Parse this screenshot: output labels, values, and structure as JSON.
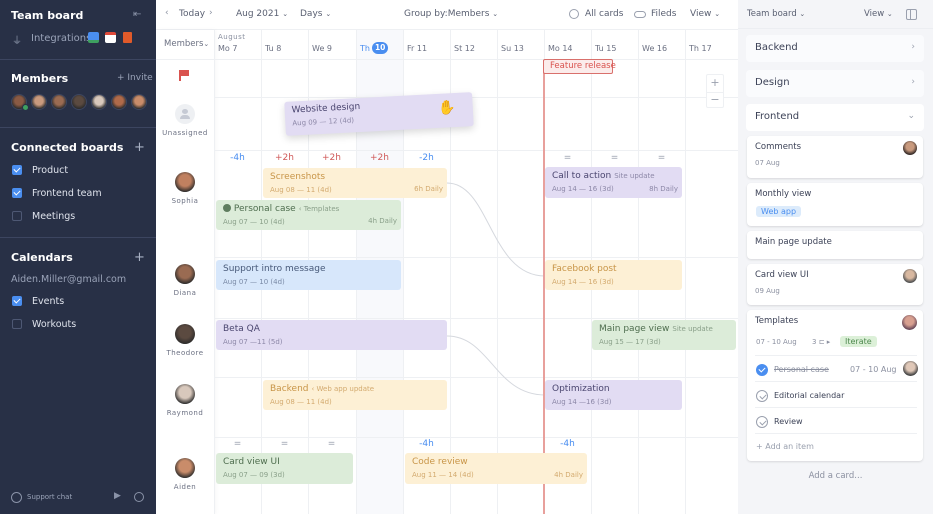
{
  "sidebar": {
    "title": "Team board",
    "integrations_label": "Integrations",
    "members_title": "Members",
    "invite_label": "+ Invite",
    "member_avatars": [
      "#8a5a44",
      "#c99a7e",
      "#9a6b52",
      "#5b4a40",
      "#d8c8bc",
      "#b06a4a",
      "#c98c6a"
    ],
    "connected_title": "Connected boards",
    "connected_boards": [
      {
        "label": "Product",
        "checked": true
      },
      {
        "label": "Frontend team",
        "checked": true
      },
      {
        "label": "Meetings",
        "checked": false
      }
    ],
    "calendars_title": "Calendars",
    "calendar_account": "Aiden.Miller@gmail.com",
    "calendars": [
      {
        "label": "Events",
        "checked": true
      },
      {
        "label": "Workouts",
        "checked": false
      }
    ],
    "support_label": "Support chat"
  },
  "toolbar": {
    "today": "Today",
    "month": "Aug 2021",
    "range": "Days",
    "group_by_prefix": "Group by:",
    "group_by_value": "Members",
    "all_cards": "All cards",
    "fields": "Fileds",
    "view": "View"
  },
  "grid": {
    "members_header": "Members",
    "month_label": "August",
    "days": [
      "Mo 7",
      "Tu 8",
      "We 9",
      "Th",
      "Fr 11",
      "St 12",
      "Su 13",
      "Mo 14",
      "Tu 15",
      "We 16",
      "Th 17"
    ],
    "today_number": "10",
    "milestone": "Feature release",
    "unassigned_label": "Unassigned",
    "members": [
      "Sophia",
      "Diana",
      "Theodore",
      "Raymond",
      "Aiden"
    ],
    "sophia_hours": [
      "-4h",
      "+2h",
      "+2h",
      "+2h",
      "-2h",
      "",
      "",
      "=",
      "=",
      "="
    ],
    "aiden_hours": [
      "=",
      "=",
      "=",
      "",
      "-4h",
      "",
      "",
      "-4h"
    ]
  },
  "cards": {
    "website_design": {
      "title": "Website design",
      "dates": "Aug 09 — 12 (4d)"
    },
    "screenshots": {
      "title": "Screenshots",
      "dates": "Aug 08 — 11 (4d)",
      "rate": "6h Daily"
    },
    "personal_case": {
      "title": "Personal case",
      "tag": "Templates",
      "dates": "Aug 07 — 10 (4d)",
      "rate": "4h Daily"
    },
    "call_to_action": {
      "title": "Call to action",
      "tag": "Site update",
      "dates": "Aug 14 — 16 (3d)",
      "rate": "8h Daily"
    },
    "support_intro": {
      "title": "Support intro message",
      "dates": "Aug 07 — 10 (4d)"
    },
    "facebook_post": {
      "title": "Facebook post",
      "dates": "Aug 14 — 16 (3d)"
    },
    "beta_qa": {
      "title": "Beta QA",
      "dates": "Aug 07 —11 (5d)"
    },
    "main_page_view": {
      "title": "Main page view",
      "tag": "Site update",
      "dates": "Aug 15 — 17 (3d)"
    },
    "backend": {
      "title": "Backend",
      "tag": "Web app update",
      "dates": "Aug 08 — 11 (4d)"
    },
    "optimization": {
      "title": "Optimization",
      "dates": "Aug 14 —16 (3d)"
    },
    "card_view_ui": {
      "title": "Card view UI",
      "dates": "Aug 07 — 09 (3d)"
    },
    "code_review": {
      "title": "Code review",
      "dates": "Aug 11 — 14 (4d)",
      "rate": "4h Daily"
    }
  },
  "right_panel": {
    "board": "Team board",
    "view": "View",
    "groups": [
      "Backend",
      "Design",
      "Frontend"
    ],
    "cards": [
      {
        "title": "Comments",
        "date": "07 Aug"
      },
      {
        "title": "Monthly view",
        "tag": "Web app"
      },
      {
        "title": "Main page update"
      },
      {
        "title": "Card view UI",
        "date": "09 Aug"
      }
    ],
    "templates": {
      "title": "Templates",
      "date": "07 - 10 Aug",
      "subtasks": "3",
      "tag": "Iterate",
      "items": [
        {
          "label": "Personal case",
          "done": true,
          "date": "07 - 10 Aug"
        },
        {
          "label": "Editorial calendar",
          "done": false
        },
        {
          "label": "Review",
          "done": false
        }
      ],
      "add_item": "+ Add an item"
    },
    "add_card": "Add a card..."
  },
  "colors": {
    "accent": "#4a8ef0",
    "sidebar_bg": "#283046",
    "milestone": "#e08a86",
    "positive_hours": "#d05a5a",
    "negative_hours": "#4a8ef0"
  }
}
